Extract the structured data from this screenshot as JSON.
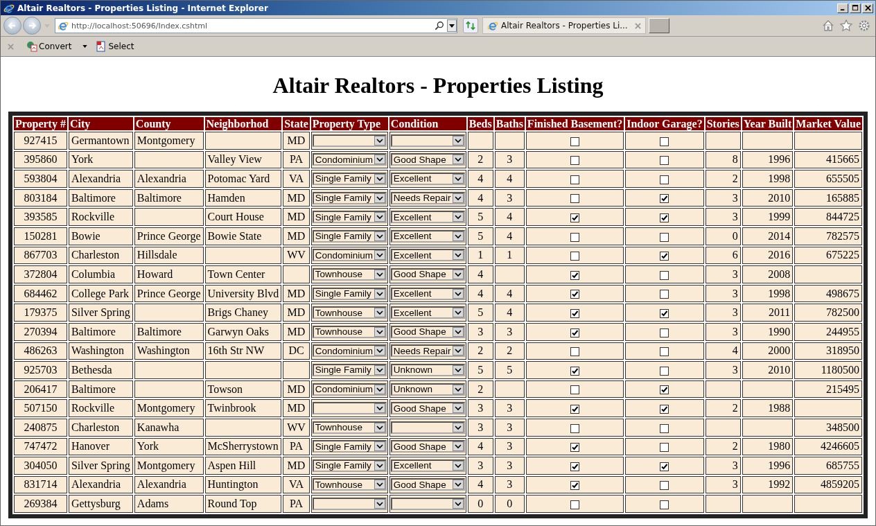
{
  "window": {
    "title": "Altair Realtors - Properties Listing - Internet Explorer"
  },
  "address_bar": {
    "url": "http://localhost:50696/Index.cshtml"
  },
  "tabs": [
    {
      "label": "Altair Realtors - Properties Li...",
      "selected": true
    }
  ],
  "command_bar": [
    {
      "label": "Convert",
      "kind": "menu"
    },
    {
      "label": "Select",
      "kind": "button"
    }
  ],
  "page": {
    "heading": "Altair Realtors - Properties Listing"
  },
  "table": {
    "columns": [
      {
        "label": "Property #",
        "kind": "center"
      },
      {
        "label": "City",
        "kind": "text"
      },
      {
        "label": "County",
        "kind": "text"
      },
      {
        "label": "Neighborhod",
        "kind": "text"
      },
      {
        "label": "State",
        "kind": "center"
      },
      {
        "label": "Property Type",
        "kind": "dropdown"
      },
      {
        "label": "Condition",
        "kind": "dropdown"
      },
      {
        "label": "Beds",
        "kind": "center"
      },
      {
        "label": "Baths",
        "kind": "center"
      },
      {
        "label": "Finished Basement?",
        "kind": "checkbox"
      },
      {
        "label": "Indoor Garage?",
        "kind": "checkbox"
      },
      {
        "label": "Stories",
        "kind": "right"
      },
      {
        "label": "Year Built",
        "kind": "right"
      },
      {
        "label": "Market Value",
        "kind": "right"
      }
    ],
    "rows": [
      [
        "927415",
        "Germantown",
        "Montgomery",
        null,
        "MD",
        null,
        null,
        null,
        null,
        {
          "checked": false
        },
        {
          "checked": false
        },
        null,
        null,
        null
      ],
      [
        "395860",
        "York",
        null,
        "Valley View",
        "PA",
        "Condominium",
        "Good Shape",
        "2",
        "3",
        {
          "checked": false
        },
        {
          "checked": false
        },
        "8",
        "1996",
        "415665"
      ],
      [
        "593804",
        "Alexandria",
        "Alexandria",
        "Potomac Yard",
        "VA",
        "Single Family",
        "Excellent",
        "4",
        "4",
        {
          "checked": false
        },
        {
          "checked": false
        },
        "2",
        "1998",
        "655505"
      ],
      [
        "803184",
        "Baltimore",
        "Baltimore",
        "Hamden",
        "MD",
        "Single Family",
        "Needs Repair",
        "4",
        "3",
        {
          "checked": false
        },
        {
          "checked": true
        },
        "3",
        "2010",
        "165885"
      ],
      [
        "393585",
        "Rockville",
        null,
        "Court House",
        "MD",
        "Single Family",
        "Excellent",
        "5",
        "4",
        {
          "checked": true
        },
        {
          "checked": true
        },
        "3",
        "1999",
        "844725"
      ],
      [
        "150281",
        "Bowie",
        "Prince George",
        "Bowie State",
        "MD",
        "Single Family",
        "Excellent",
        "5",
        "4",
        {
          "checked": false
        },
        {
          "checked": false
        },
        "0",
        "2014",
        "782575"
      ],
      [
        "867703",
        "Charleston",
        "Hillsdale",
        null,
        "WV",
        "Condominium",
        "Excellent",
        "1",
        "1",
        {
          "checked": false
        },
        {
          "checked": true
        },
        "6",
        "2016",
        "675225"
      ],
      [
        "372804",
        "Columbia",
        "Howard",
        "Town Center",
        null,
        "Townhouse",
        "Good Shape",
        "4",
        null,
        {
          "checked": true
        },
        {
          "checked": false
        },
        "3",
        "2008",
        null
      ],
      [
        "684462",
        "College Park",
        "Prince George",
        "University Blvd",
        "MD",
        "Single Family",
        "Excellent",
        "4",
        "4",
        {
          "checked": true
        },
        {
          "checked": false
        },
        "3",
        "1998",
        "498675"
      ],
      [
        "179375",
        "Silver Spring",
        null,
        "Brigs Chaney",
        "MD",
        "Townhouse",
        "Excellent",
        "5",
        "4",
        {
          "checked": true
        },
        {
          "checked": true
        },
        "3",
        "2011",
        "782500"
      ],
      [
        "270394",
        "Baltimore",
        "Baltimore",
        "Garwyn Oaks",
        "MD",
        "Townhouse",
        "Good Shape",
        "3",
        "3",
        {
          "checked": true
        },
        {
          "checked": false
        },
        "3",
        "1990",
        "244955"
      ],
      [
        "486263",
        "Washington",
        "Washington",
        "16th Str NW",
        "DC",
        "Condominium",
        "Needs Repair",
        "2",
        "2",
        {
          "checked": false
        },
        {
          "checked": false
        },
        "4",
        "2000",
        "318950"
      ],
      [
        "925703",
        "Bethesda",
        null,
        null,
        null,
        "Single Family",
        "Unknown",
        "5",
        "5",
        {
          "checked": true
        },
        {
          "checked": false
        },
        "3",
        "2010",
        "1180500"
      ],
      [
        "206417",
        "Baltimore",
        null,
        "Towson",
        "MD",
        "Condominium",
        "Unknown",
        "2",
        null,
        {
          "checked": false
        },
        {
          "checked": true
        },
        null,
        null,
        "215495"
      ],
      [
        "507150",
        "Rockville",
        "Montgomery",
        "Twinbrook",
        "MD",
        null,
        "Good Shape",
        "3",
        "3",
        {
          "checked": true
        },
        {
          "checked": true
        },
        "2",
        "1988",
        null
      ],
      [
        "240875",
        "Charleston",
        "Kanawha",
        null,
        "WV",
        "Townhouse",
        null,
        "3",
        "3",
        {
          "checked": false
        },
        {
          "checked": false
        },
        null,
        null,
        "348500"
      ],
      [
        "747472",
        "Hanover",
        "York",
        "McSherrystown",
        "PA",
        "Single Family",
        "Good Shape",
        "4",
        "3",
        {
          "checked": true
        },
        {
          "checked": false
        },
        "2",
        "1980",
        "4246605"
      ],
      [
        "304050",
        "Silver Spring",
        "Montgomery",
        "Aspen Hill",
        "MD",
        "Single Family",
        "Excellent",
        "3",
        "3",
        {
          "checked": true
        },
        {
          "checked": true
        },
        "3",
        "1996",
        "685755"
      ],
      [
        "831714",
        "Alexandria",
        "Alexandria",
        "Huntington",
        "VA",
        "Townhouse",
        "Good Shape",
        "4",
        "3",
        {
          "checked": true
        },
        {
          "checked": false
        },
        "3",
        "1992",
        "4859205"
      ],
      [
        "269384",
        "Gettysburg",
        "Adams",
        "Round Top",
        "PA",
        null,
        null,
        "0",
        "0",
        {
          "checked": false
        },
        {
          "checked": false
        },
        null,
        null,
        null
      ]
    ]
  }
}
